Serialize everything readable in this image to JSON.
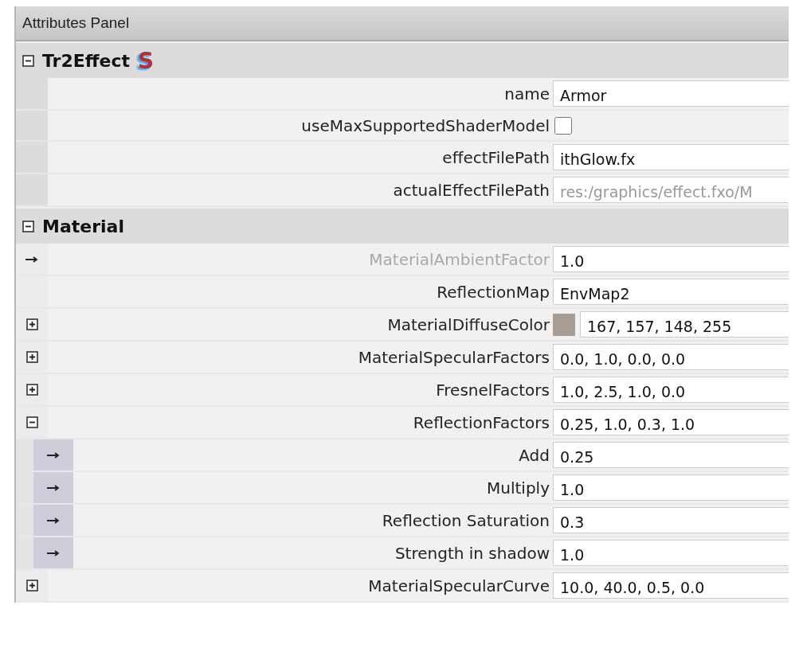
{
  "panel": {
    "title": "Attributes Panel"
  },
  "sections": [
    {
      "title": "Tr2Effect",
      "expanded": true,
      "badge": "S",
      "rows": [
        {
          "label": "name",
          "kind": "text",
          "value": "Armor"
        },
        {
          "label": "useMaxSupportedShaderModel",
          "kind": "checkbox",
          "checked": false
        },
        {
          "label": "effectFilePath",
          "kind": "text",
          "value": "ithGlow.fx"
        },
        {
          "label": "actualEffectFilePath",
          "kind": "readonly",
          "value": "res:/graphics/effect.fxo/M"
        }
      ]
    },
    {
      "title": "Material",
      "expanded": true,
      "rows": [
        {
          "label": "MaterialAmbientFactor",
          "kind": "text",
          "value": "1.0",
          "linked": true,
          "dimmed": true
        },
        {
          "label": "ReflectionMap",
          "kind": "text",
          "value": "EnvMap2"
        },
        {
          "label": "MaterialDiffuseColor",
          "kind": "color",
          "color": "#a79d94",
          "value": "167, 157, 148, 255",
          "expanded": false
        },
        {
          "label": "MaterialSpecularFactors",
          "kind": "text",
          "value": "0.0, 1.0, 0.0, 0.0",
          "expanded": false
        },
        {
          "label": "FresnelFactors",
          "kind": "text",
          "value": "1.0, 2.5, 1.0, 0.0",
          "expanded": false
        },
        {
          "label": "ReflectionFactors",
          "kind": "text",
          "value": "0.25, 1.0, 0.3, 1.0",
          "expanded": true,
          "children": [
            {
              "label": "Add",
              "kind": "text",
              "value": "0.25",
              "linked": true
            },
            {
              "label": "Multiply",
              "kind": "text",
              "value": "1.0",
              "linked": true
            },
            {
              "label": "Reflection Saturation",
              "kind": "text",
              "value": "0.3",
              "linked": true
            },
            {
              "label": "Strength in shadow",
              "kind": "text",
              "value": "1.0",
              "linked": true
            }
          ]
        },
        {
          "label": "MaterialSpecularCurve",
          "kind": "text",
          "value": "10.0, 40.0, 0.5, 0.0",
          "expanded": false
        }
      ]
    }
  ]
}
